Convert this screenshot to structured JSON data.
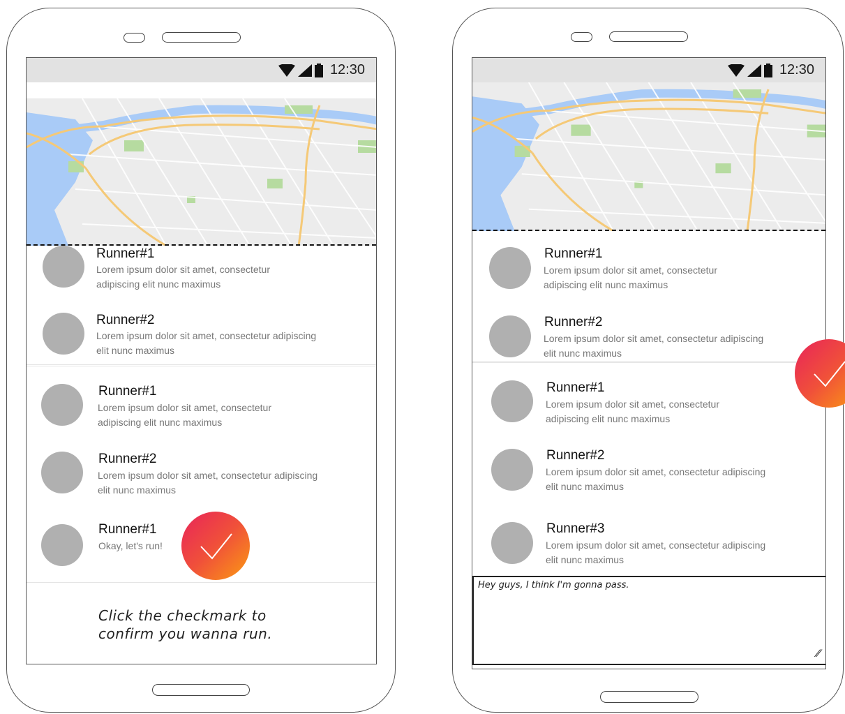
{
  "left_phone": {
    "status": {
      "time": "12:30"
    },
    "list": [
      {
        "name": "Runner#1",
        "desc_line1": "Lorem ipsum dolor sit amet, consectetur",
        "desc_line2": "adipiscing elit nunc maximus"
      },
      {
        "name": "Runner#2",
        "desc_line1": "Lorem ipsum dolor sit amet, consectetur adipiscing",
        "desc_line2": "elit nunc maximus"
      },
      {
        "name": "Runner#1",
        "desc_line1": "Lorem ipsum dolor sit amet, consectetur",
        "desc_line2": "adipiscing elit nunc maximus"
      },
      {
        "name": "Runner#2",
        "desc_line1": "Lorem ipsum dolor sit amet, consectetur adipiscing",
        "desc_line2": "elit nunc maximus"
      },
      {
        "name": "Runner#1",
        "desc_line1": "Okay, let's run!",
        "desc_line2": ""
      }
    ],
    "note_line1": "Click the checkmark to",
    "note_line2": "confirm you wanna run."
  },
  "right_phone": {
    "status": {
      "time": "12:30"
    },
    "list": [
      {
        "name": "Runner#1",
        "desc_line1": "Lorem ipsum dolor sit amet, consectetur",
        "desc_line2": "adipiscing elit nunc maximus"
      },
      {
        "name": "Runner#2",
        "desc_line1": "Lorem ipsum dolor sit amet, consectetur adipiscing",
        "desc_line2": "elit nunc maximus"
      },
      {
        "name": "Runner#1",
        "desc_line1": "Lorem ipsum dolor sit amet, consectetur",
        "desc_line2": "adipiscing elit nunc maximus"
      },
      {
        "name": "Runner#2",
        "desc_line1": "Lorem ipsum dolor sit amet, consectetur adipiscing",
        "desc_line2": "elit nunc maximus"
      },
      {
        "name": "Runner#3",
        "desc_line1": "Lorem ipsum dolor sit amet, consectetur adipiscing",
        "desc_line2": "elit nunc maximus"
      }
    ],
    "message_value": "Hey guys, I think I'm gonna pass."
  },
  "colors": {
    "fab_start": "#e8245a",
    "fab_end": "#fb9b12",
    "avatar": "#b0b0b0",
    "statusbar": "#e2e2e2"
  },
  "icons": [
    "wifi-icon",
    "signal-icon",
    "battery-icon",
    "checkmark-icon",
    "resize-handle-icon"
  ]
}
